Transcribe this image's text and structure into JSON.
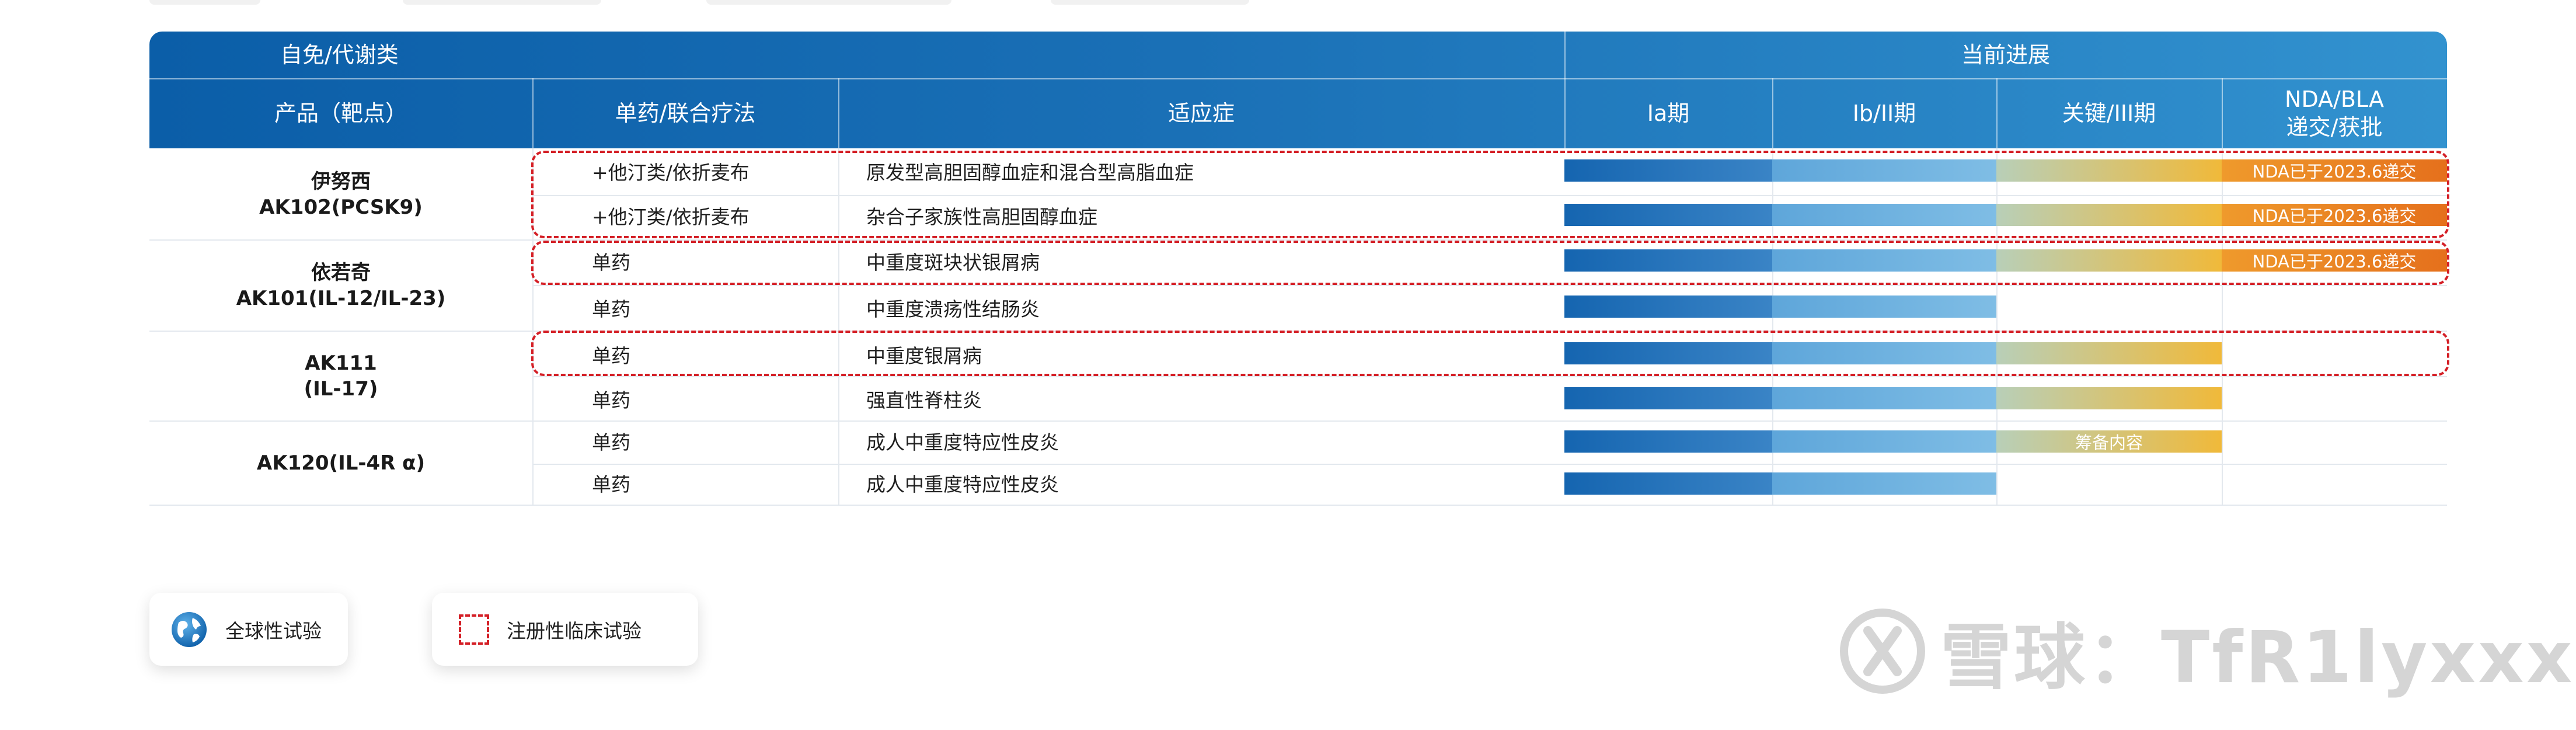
{
  "header": {
    "group_left": "自免/代谢类",
    "group_right": "当前进展",
    "col_product": "产品（靶点）",
    "col_therapy": "单药/联合疗法",
    "col_indication": "适应症",
    "col_phase1a": "Ia期",
    "col_phase1b": "Ib/II期",
    "col_pivotal": "关键/III期",
    "col_nda_line1": "NDA/BLA",
    "col_nda_line2": "递交/获批"
  },
  "products": [
    {
      "name": "伊努西\nAK102(PCSK9)"
    },
    {
      "name": "依若奇\nAK101(IL-12/IL-23)"
    },
    {
      "name": "AK111\n(IL-17)"
    },
    {
      "name": "AK120(IL-4R α)"
    }
  ],
  "rows": [
    {
      "therapy": "+他汀类/依折麦布",
      "indication": "原发型高胆固醇血症和混合型高脂血症",
      "progress_stage": 4,
      "status_label": "NDA已于2023.6递交"
    },
    {
      "therapy": "+他汀类/依折麦布",
      "indication": "杂合子家族性高胆固醇血症",
      "progress_stage": 4,
      "status_label": "NDA已于2023.6递交"
    },
    {
      "therapy": "单药",
      "indication": "中重度斑块状银屑病",
      "progress_stage": 4,
      "status_label": "NDA已于2023.6递交"
    },
    {
      "therapy": "单药",
      "indication": "中重度溃疡性结肠炎",
      "progress_stage": 2,
      "status_label": ""
    },
    {
      "therapy": "单药",
      "indication": "中重度银屑病",
      "progress_stage": 3,
      "status_label": ""
    },
    {
      "therapy": "单药",
      "indication": "强直性脊柱炎",
      "progress_stage": 3,
      "status_label": ""
    },
    {
      "therapy": "单药",
      "indication": "成人中重度特应性皮炎",
      "progress_stage": 3,
      "status_label": "筹备内容"
    },
    {
      "therapy": "单药",
      "indication": "成人中重度特应性皮炎",
      "progress_stage": 2,
      "status_label": ""
    }
  ],
  "legend": {
    "global_trial": "全球性试验",
    "registration_trial": "注册性临床试验"
  },
  "watermark": "雪球：TfR1lyxxx",
  "colors": {
    "header_dark": "#0b5ea8",
    "header_light": "#3292cf",
    "stage1": "#1565b0",
    "stage2": "#7fbde5",
    "stage3": "#f0b93a",
    "stage4": "#e5701c",
    "dash_red": "#d41f26"
  }
}
